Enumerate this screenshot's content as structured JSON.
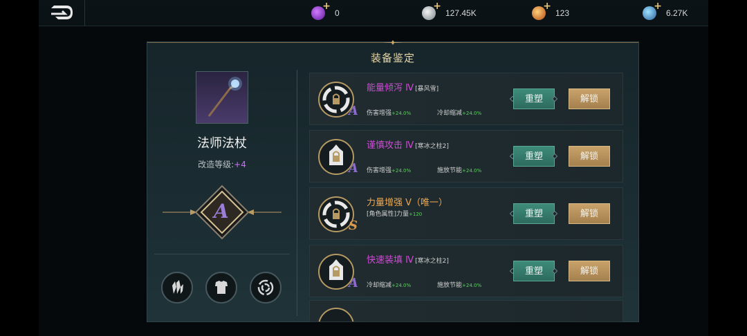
{
  "currencies": [
    {
      "icon": "purple-gem-icon",
      "value": "0",
      "color": "#8a3bd0"
    },
    {
      "icon": "silver-coin-icon",
      "value": "127.45K",
      "color": "#9aa5ad"
    },
    {
      "icon": "gold-orb-icon",
      "value": "123",
      "color": "#d9722a"
    },
    {
      "icon": "blue-crystal-icon",
      "value": "6.27K",
      "color": "#4a8fc4"
    }
  ],
  "panel": {
    "title": "装备鉴定"
  },
  "item": {
    "name": "法师法杖",
    "refine_label": "改造等级:",
    "refine_value": "+4",
    "grade": "A"
  },
  "bottom_icons": [
    "crystal-icon",
    "armor-icon",
    "vortex-icon"
  ],
  "buttons": {
    "reshape": "重塑",
    "unlock": "解锁"
  },
  "affixes": [
    {
      "name": "能量倾泻 Ⅳ",
      "tag": "[暴风雪]",
      "name_color": "#d04bd6",
      "grade": "A",
      "grade_color": "#8d6ad0",
      "stats": [
        {
          "label": "伤害增强",
          "value": "+24.0%"
        },
        {
          "label": "冷却缩减",
          "value": "+24.0%"
        }
      ]
    },
    {
      "name": "谨慎攻击 Ⅳ",
      "tag": "[寒冰之柱2]",
      "name_color": "#d04bd6",
      "grade": "A",
      "grade_color": "#8d6ad0",
      "stats": [
        {
          "label": "伤害增强",
          "value": "+24.0%"
        },
        {
          "label": "施放节能",
          "value": "+24.0%"
        }
      ]
    },
    {
      "name": "力量增强 Ⅴ（唯一）",
      "tag": "",
      "name_color": "#f0a64a",
      "grade": "S",
      "grade_color": "#d89a4e",
      "single_stat": {
        "label": "[角色属性]力量",
        "value": "+120"
      }
    },
    {
      "name": "快速装填 Ⅳ",
      "tag": "[寒冰之柱2]",
      "name_color": "#d04bd6",
      "grade": "A",
      "grade_color": "#8d6ad0",
      "stats": [
        {
          "label": "冷却缩减",
          "value": "+24.0%"
        },
        {
          "label": "施放节能",
          "value": "+24.0%"
        }
      ]
    }
  ]
}
